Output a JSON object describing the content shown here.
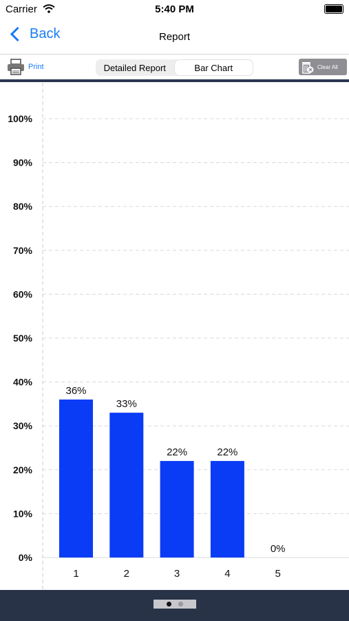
{
  "status": {
    "carrier": "Carrier",
    "time": "5:40 PM"
  },
  "nav": {
    "back_label": "Back",
    "title": "Report"
  },
  "toolbar": {
    "print_label": "Print",
    "tabs": [
      {
        "label": "Detailed Report",
        "active": false
      },
      {
        "label": "Bar Chart",
        "active": true
      }
    ],
    "clear_label": "Clear All"
  },
  "pager": {
    "pages": 2,
    "current": 1
  },
  "colors": {
    "accent": "#1a7cf5",
    "bar": "#0a3cf5",
    "footer": "#283347"
  },
  "chart_data": {
    "type": "bar",
    "categories": [
      "1",
      "2",
      "3",
      "4",
      "5"
    ],
    "values": [
      36,
      33,
      22,
      22,
      0
    ],
    "value_labels": [
      "36%",
      "33%",
      "22%",
      "22%",
      "0%"
    ],
    "yticks": [
      "0%",
      "10%",
      "20%",
      "30%",
      "40%",
      "50%",
      "60%",
      "70%",
      "80%",
      "90%",
      "100%"
    ],
    "ylim": [
      0,
      100
    ],
    "grid": true,
    "title": "",
    "xlabel": "",
    "ylabel": ""
  }
}
